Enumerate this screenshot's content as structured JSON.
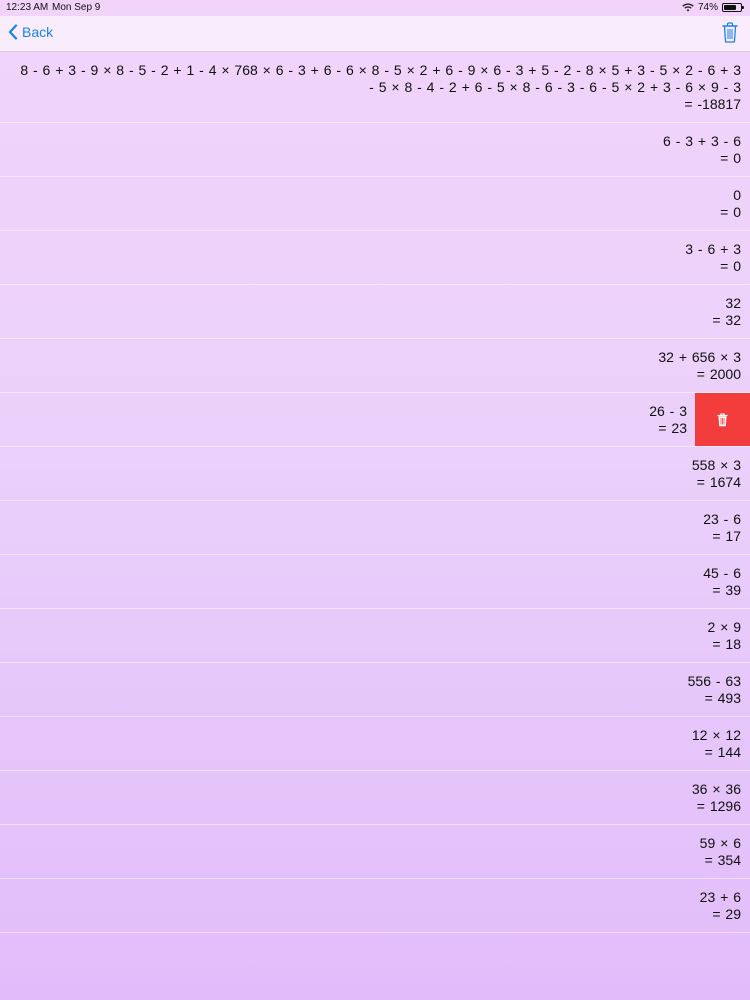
{
  "status_bar": {
    "time": "12:23 AM",
    "date": "Mon Sep 9",
    "battery": "74%",
    "battery_level": 0.74
  },
  "nav": {
    "back_label": "Back",
    "trash_icon": "trash-icon"
  },
  "history": [
    {
      "expression": "8 - 6 + 3 - 9 × 8 - 5 - 2 + 1 - 4 × 768 × 6 - 3 + 6 - 6 × 8 - 5 × 2 + 6 - 9 × 6 - 3 + 5 - 2 - 8 × 5 + 3 - 5 × 2 - 6 + 3 - 5 × 8 - 4 - 2 + 6 - 5 × 8 - 6 - 3 - 6 - 5 × 2 + 3 - 6 × 9 - 3",
      "result": "= -18817"
    },
    {
      "expression": "6 - 3 + 3 - 6",
      "result": "= 0"
    },
    {
      "expression": "0",
      "result": "= 0"
    },
    {
      "expression": "3 - 6 + 3",
      "result": "= 0"
    },
    {
      "expression": "32",
      "result": "= 32"
    },
    {
      "expression": "32 + 656 × 3",
      "result": "= 2000"
    },
    {
      "expression": "26 - 3",
      "result": "= 23",
      "swiped": true
    },
    {
      "expression": "558 × 3",
      "result": "= 1674"
    },
    {
      "expression": "23 - 6",
      "result": "= 17"
    },
    {
      "expression": "45 - 6",
      "result": "= 39"
    },
    {
      "expression": "2 × 9",
      "result": "= 18"
    },
    {
      "expression": "556 - 63",
      "result": "= 493"
    },
    {
      "expression": "12 × 12",
      "result": "= 144"
    },
    {
      "expression": "36 × 36",
      "result": "= 1296"
    },
    {
      "expression": "59 × 6",
      "result": "= 354"
    },
    {
      "expression": "23 + 6",
      "result": "= 29"
    }
  ],
  "delete_action_icon": "trash-icon",
  "colors": {
    "accent": "#1a84e6",
    "delete": "#f33c3c"
  }
}
